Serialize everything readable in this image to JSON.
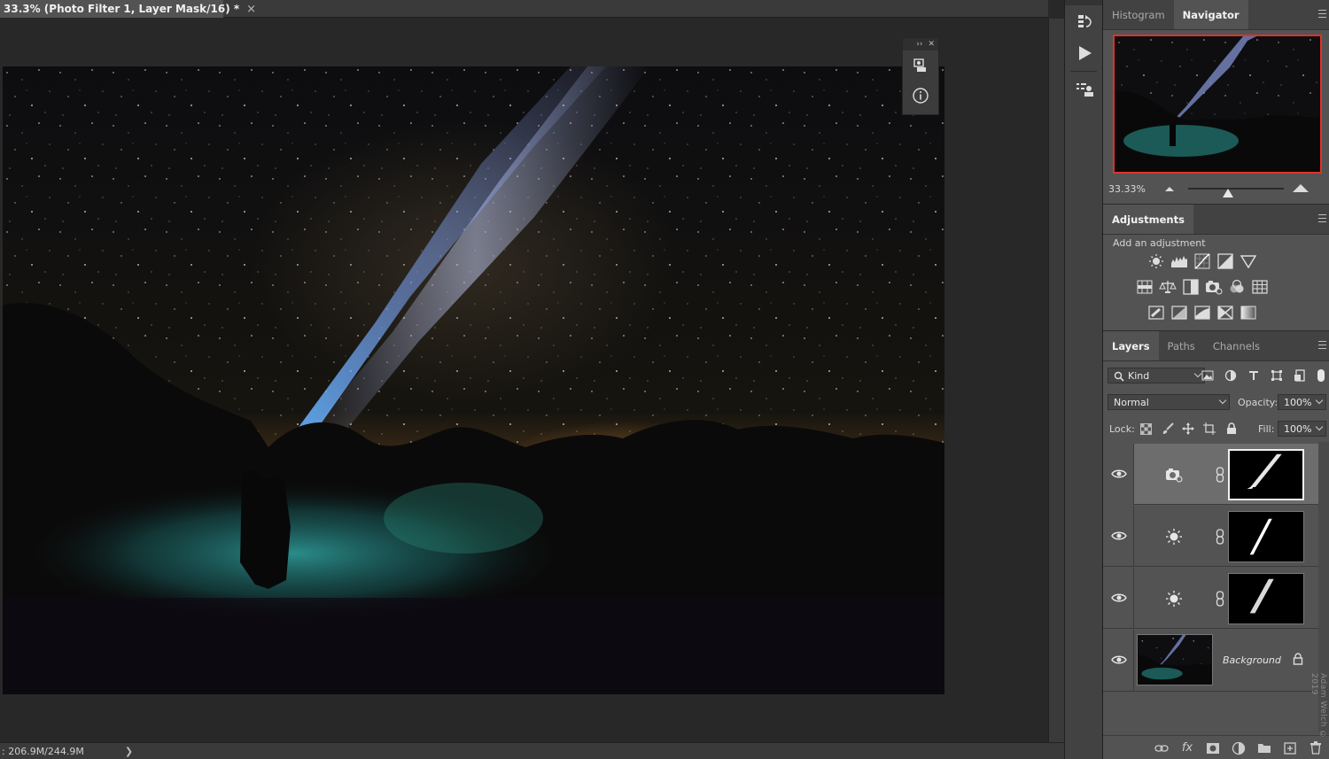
{
  "document": {
    "tab_title": "33.3% (Photo Filter 1, Layer Mask/16) *",
    "tab_close": "×"
  },
  "status": {
    "doc_size": ": 206.9M/244.9M",
    "chevron": "❯"
  },
  "float_panel": {
    "collapse": "››",
    "close": "✕",
    "buttons": [
      "3d-material-icon",
      "info-icon"
    ]
  },
  "icon_strip": {
    "buttons": [
      "history-icon",
      "play-action-icon",
      "properties-icon"
    ]
  },
  "navigator": {
    "tabs": [
      "Histogram",
      "Navigator"
    ],
    "active_tab": "Navigator",
    "zoom_text": "33.33%",
    "zoom_level": 0.333,
    "proxy_color": "#e0312c"
  },
  "adjustments": {
    "tab": "Adjustments",
    "label": "Add an adjustment",
    "row1": [
      "brightness-contrast-icon",
      "levels-icon",
      "curves-icon",
      "exposure-icon",
      "vibrance-icon"
    ],
    "row2": [
      "hue-saturation-icon",
      "color-balance-icon",
      "black-white-icon",
      "photo-filter-icon",
      "channel-mixer-icon",
      "color-lookup-icon"
    ],
    "row3": [
      "invert-icon",
      "posterize-icon",
      "threshold-icon",
      "selective-color-icon",
      "gradient-map-icon"
    ]
  },
  "layers": {
    "tabs": [
      "Layers",
      "Paths",
      "Channels"
    ],
    "active_tab": "Layers",
    "filter_kind": "Kind",
    "blend_mode": "Normal",
    "opacity_label": "Opacity:",
    "opacity_value": "100%",
    "lock_label": "Lock:",
    "fill_label": "Fill:",
    "fill_value": "100%",
    "items": [
      {
        "type": "photo-filter",
        "selected": true,
        "visible": true,
        "icon": "photo-filter-icon"
      },
      {
        "type": "brightness-contrast",
        "selected": false,
        "visible": true,
        "icon": "brightness-contrast-icon"
      },
      {
        "type": "brightness-contrast",
        "selected": false,
        "visible": true,
        "icon": "brightness-contrast-icon"
      },
      {
        "type": "pixel",
        "selected": false,
        "visible": true,
        "name": "Background",
        "locked": true
      }
    ],
    "footer": [
      "link-layers-icon",
      "fx-icon",
      "add-mask-icon",
      "new-adjustment-icon",
      "new-group-icon",
      "new-layer-icon",
      "delete-icon"
    ],
    "footer_fx": "fx"
  },
  "watermark": "Adam Welch © 2019"
}
